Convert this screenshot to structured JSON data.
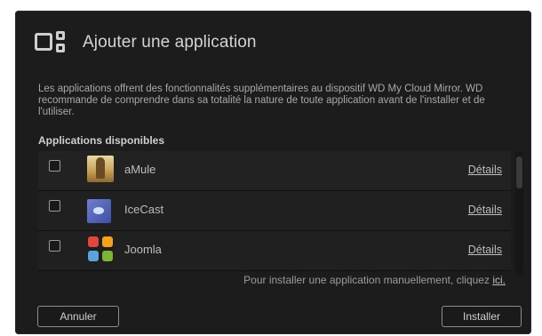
{
  "dialog": {
    "title": "Ajouter une application",
    "description": "Les applications offrent des fonctionnalités supplémentaires au dispositif WD My Cloud Mirror. WD recommande de comprendre dans sa totalité la nature de toute application avant de l'installer et de l'utiliser.",
    "section_label": "Applications disponibles",
    "apps": [
      {
        "name": "aMule",
        "details_label": "Détails",
        "checked": false,
        "icon": "amule-icon"
      },
      {
        "name": "IceCast",
        "details_label": "Détails",
        "checked": false,
        "icon": "icecast-icon"
      },
      {
        "name": "Joomla",
        "details_label": "Détails",
        "checked": false,
        "icon": "joomla-icon"
      }
    ],
    "manual_text": "Pour installer une application manuellement, cliquez",
    "manual_link": "ici.",
    "cancel_label": "Annuler",
    "install_label": "Installer"
  }
}
